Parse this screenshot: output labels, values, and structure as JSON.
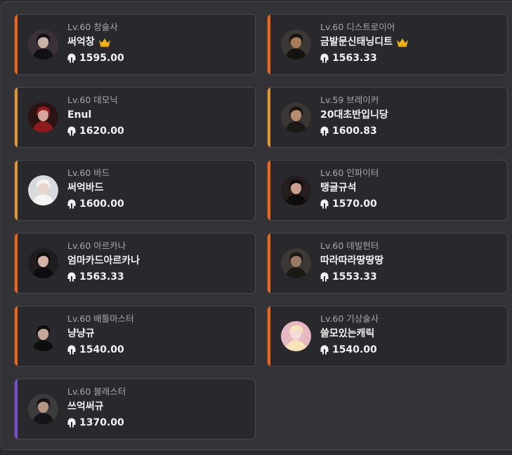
{
  "colors": {
    "orange": "#f26411",
    "amber": "#e2962a",
    "purple": "#7a4fd6"
  },
  "characters": [
    {
      "level": "Lv.60 창술사",
      "name": "써억창",
      "crown": true,
      "power": "1595.00",
      "bar": "orange",
      "avatar_bg": "#3a3238",
      "avatar_fg": "#101014",
      "face": "#c9b1a5"
    },
    {
      "level": "Lv.60 디스트로이어",
      "name": "금발문신태닝디트",
      "crown": true,
      "power": "1563.33",
      "bar": "orange",
      "avatar_bg": "#3b3835",
      "avatar_fg": "#151311",
      "face": "#a57b5a"
    },
    {
      "level": "Lv.60 데모닉",
      "name": "Enul",
      "crown": false,
      "power": "1620.00",
      "bar": "amber",
      "avatar_bg": "#2a1414",
      "avatar_fg": "#8e1c1c",
      "face": "#d8a49a"
    },
    {
      "level": "Lv.59 브레이커",
      "name": "20대초반입니당",
      "crown": false,
      "power": "1600.83",
      "bar": "amber",
      "avatar_bg": "#3a3634",
      "avatar_fg": "#1b1715",
      "face": "#b88a70"
    },
    {
      "level": "Lv.60 바드",
      "name": "써억바드",
      "crown": false,
      "power": "1600.00",
      "bar": "amber",
      "avatar_bg": "#d9dadd",
      "avatar_fg": "#f4f4f4",
      "face": "#e8d6cc"
    },
    {
      "level": "Lv.60 인파이터",
      "name": "탱글규석",
      "crown": false,
      "power": "1570.00",
      "bar": "orange",
      "avatar_bg": "#261d1f",
      "avatar_fg": "#0f0a0b",
      "face": "#caa08c"
    },
    {
      "level": "Lv.60 아르카나",
      "name": "엄마카드아르카나",
      "crown": false,
      "power": "1563.33",
      "bar": "orange",
      "avatar_bg": "#1f1d20",
      "avatar_fg": "#0d0c0e",
      "face": "#d4b2a4"
    },
    {
      "level": "Lv.60 데빌헌터",
      "name": "따라따라땅땅땅",
      "crown": false,
      "power": "1553.33",
      "bar": "orange",
      "avatar_bg": "#3b3835",
      "avatar_fg": "#1c1816",
      "face": "#9a7a66"
    },
    {
      "level": "Lv.60 배틀마스터",
      "name": "냥냥규",
      "crown": false,
      "power": "1540.00",
      "bar": "orange",
      "avatar_bg": "#2a2a2e",
      "avatar_fg": "#0d0d10",
      "face": "#c6a898"
    },
    {
      "level": "Lv.60 기상술사",
      "name": "쓸모있는캐릭",
      "crown": false,
      "power": "1540.00",
      "bar": "orange",
      "avatar_bg": "#e7b7c2",
      "avatar_fg": "#f6e3b8",
      "face": "#f4dcd6"
    },
    {
      "level": "Lv.60 블래스터",
      "name": "쓰억써규",
      "crown": false,
      "power": "1370.00",
      "bar": "purple",
      "avatar_bg": "#3c3b3c",
      "avatar_fg": "#151416",
      "face": "#b59481"
    }
  ]
}
